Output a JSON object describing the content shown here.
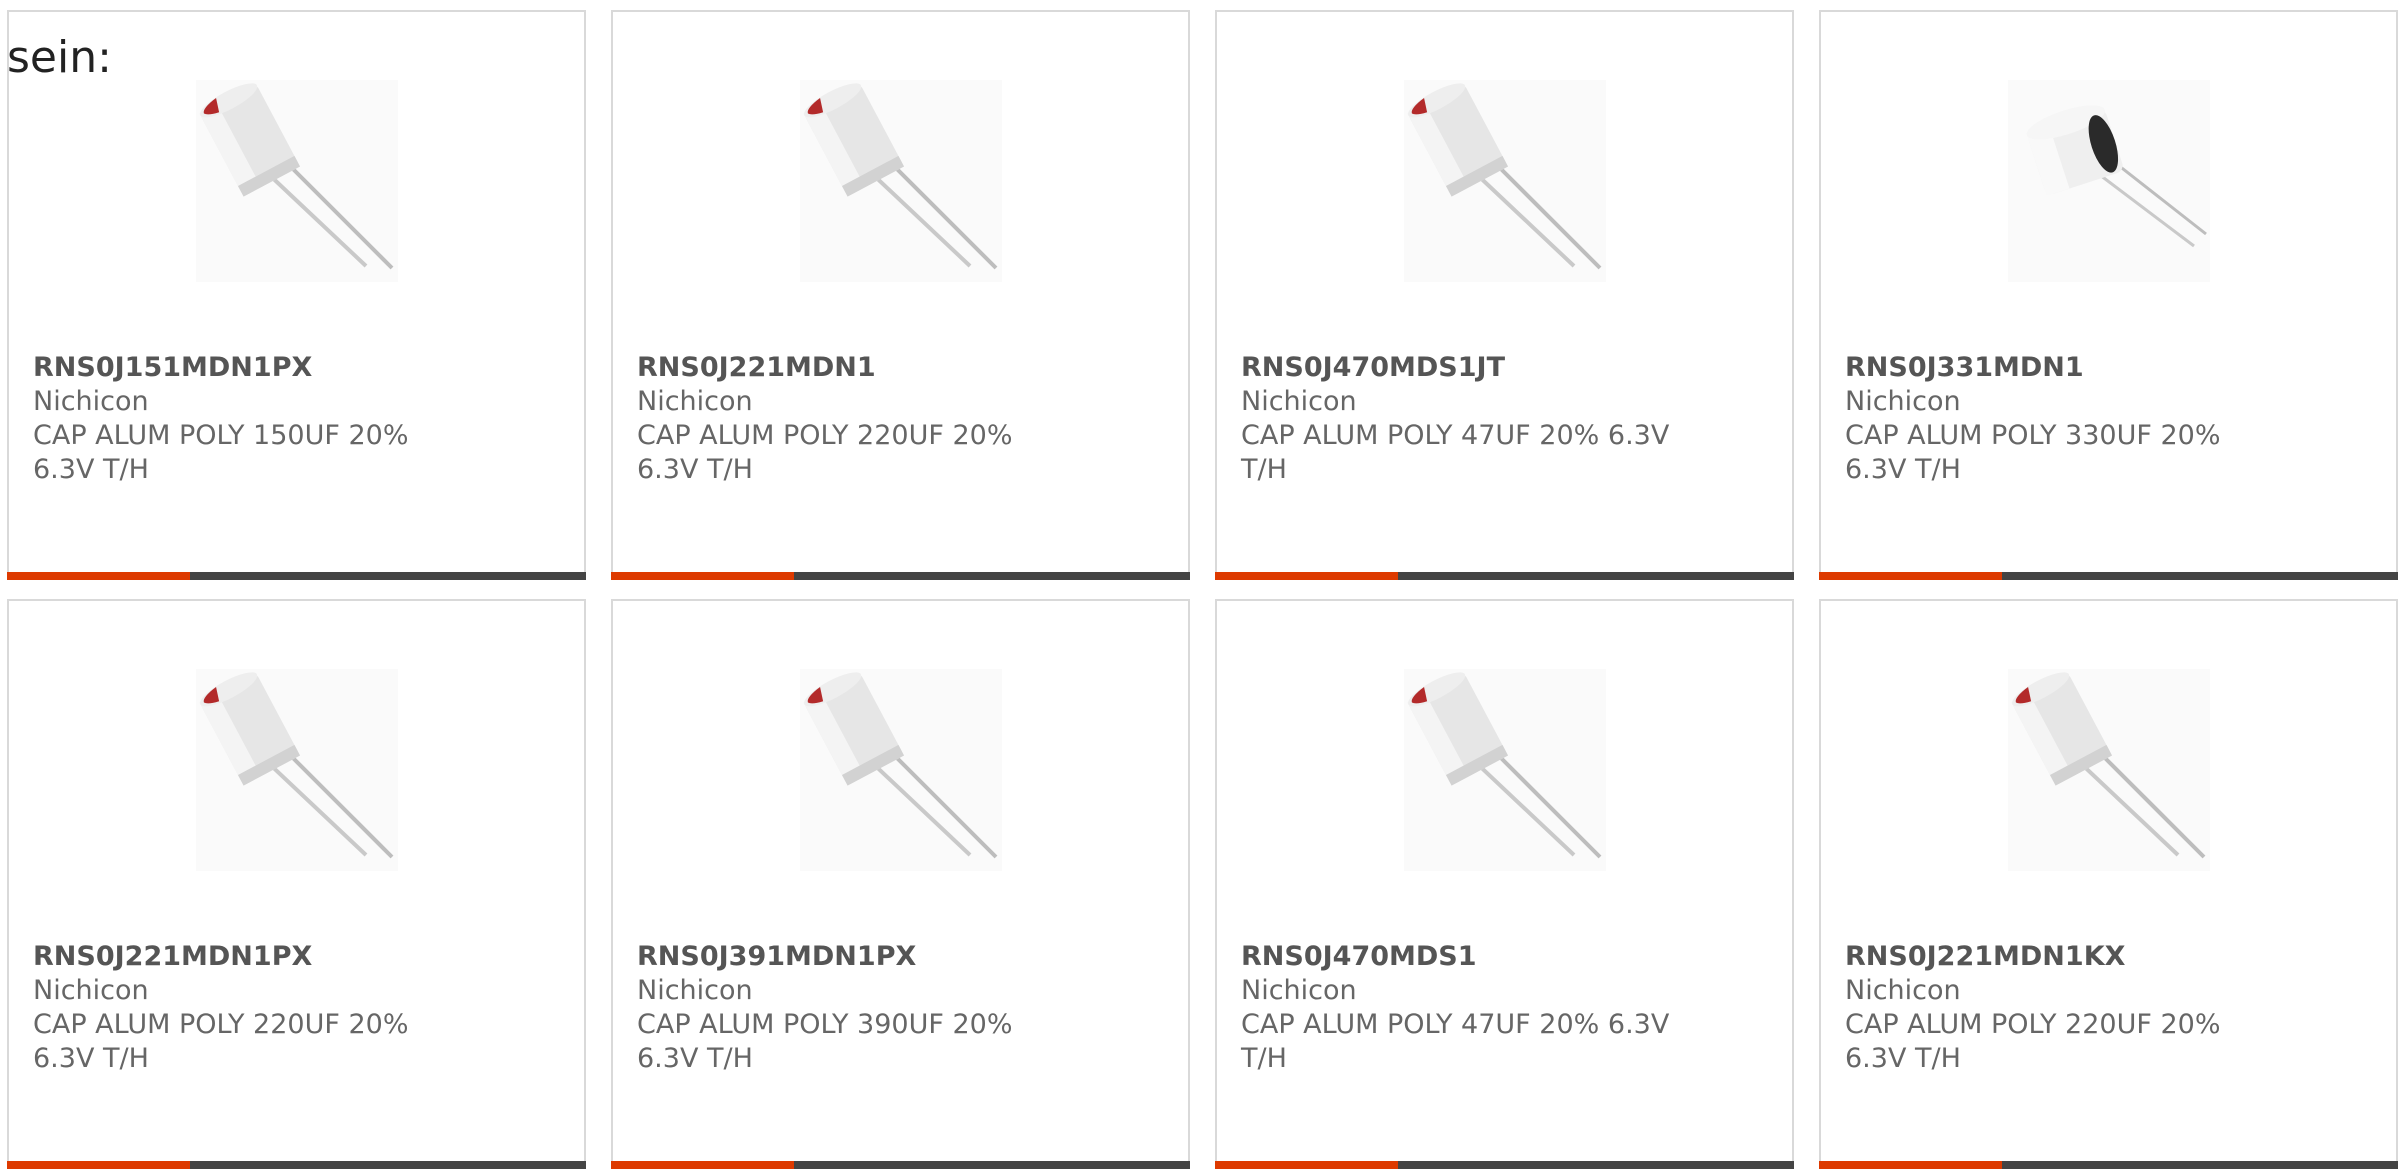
{
  "lead_text": "sein:",
  "colors": {
    "accent": "#dd3a00",
    "bar": "#444444",
    "text": "#666666",
    "border": "#d9d9d9"
  },
  "products": [
    {
      "part_number": "RNS0J151MDN1PX",
      "manufacturer": "Nichicon",
      "description": "CAP ALUM POLY 150UF 20% 6.3V T/H",
      "icon": "capacitor-radial-red-top"
    },
    {
      "part_number": "RNS0J221MDN1",
      "manufacturer": "Nichicon",
      "description": "CAP ALUM POLY 220UF 20% 6.3V T/H",
      "icon": "capacitor-radial-red-top"
    },
    {
      "part_number": "RNS0J470MDS1JT",
      "manufacturer": "Nichicon",
      "description": "CAP ALUM POLY 47UF 20% 6.3V T/H",
      "icon": "capacitor-radial-red-top"
    },
    {
      "part_number": "RNS0J331MDN1",
      "manufacturer": "Nichicon",
      "description": "CAP ALUM POLY 330UF 20% 6.3V T/H",
      "icon": "capacitor-radial-dark-bottom"
    },
    {
      "part_number": "RNS0J221MDN1PX",
      "manufacturer": "Nichicon",
      "description": "CAP ALUM POLY 220UF 20% 6.3V T/H",
      "icon": "capacitor-radial-red-top"
    },
    {
      "part_number": "RNS0J391MDN1PX",
      "manufacturer": "Nichicon",
      "description": "CAP ALUM POLY 390UF 20% 6.3V T/H",
      "icon": "capacitor-radial-red-top"
    },
    {
      "part_number": "RNS0J470MDS1",
      "manufacturer": "Nichicon",
      "description": "CAP ALUM POLY 47UF 20% 6.3V T/H",
      "icon": "capacitor-radial-red-top"
    },
    {
      "part_number": "RNS0J221MDN1KX",
      "manufacturer": "Nichicon",
      "description": "CAP ALUM POLY 220UF 20% 6.3V T/H",
      "icon": "capacitor-radial-red-top"
    }
  ]
}
